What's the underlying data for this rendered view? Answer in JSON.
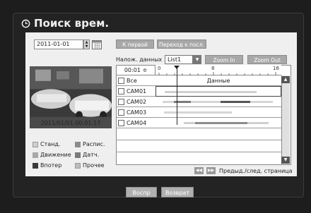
{
  "title": "Поиск врем.",
  "date": "2011-01-01",
  "buttons": {
    "first": "К первой",
    "to_last": "Переход к посл.",
    "zoom_in": "Zoom In",
    "zoom_out": "Zoom Out",
    "play": "Воспр",
    "back": "Возврат"
  },
  "overlap": {
    "label": "Налож. данных",
    "selected": "List1"
  },
  "timeline": {
    "time_value": "00:01",
    "ticks": [
      "0",
      "8",
      "16"
    ],
    "header_all": "Все",
    "header_data": "Данные",
    "cameras": [
      "CAM01",
      "CAM02",
      "CAM03",
      "CAM04"
    ]
  },
  "preview": {
    "timestamp": "2011/01/01  00:01:17"
  },
  "legend": {
    "scheduled": "Станд.",
    "schedule": "Распис.",
    "motion": "Движение",
    "sensor": "Датч.",
    "intrusion": "Впотер",
    "other": "Прочее"
  },
  "paging": {
    "label": "Предыд./след. страница"
  },
  "colors": {
    "scheduled": "#cfcfcf",
    "schedule": "#8c8c8c",
    "motion": "#a9a9a9",
    "sensor": "#7a7a7a",
    "intrusion": "#3a3a3a",
    "other": "#bdbdbd"
  }
}
